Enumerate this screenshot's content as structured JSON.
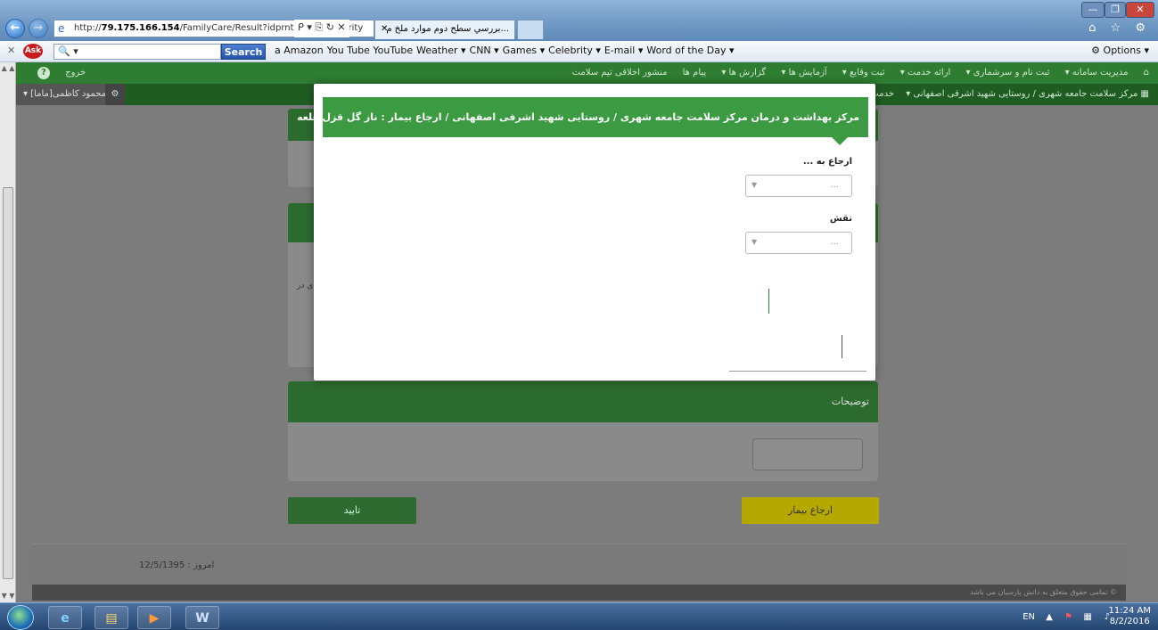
{
  "browser": {
    "url_prefix": "http://",
    "url_host": "79.175.166.154",
    "url_path": "/FamilyCare/Result?idprnt=7533&priority",
    "url_tools": "ᑭ ▾ ⎘ ↻ ✕",
    "tab_title": "...بررسي سطح دوم موارد ملخ م",
    "tab_close": "✕",
    "window_controls": [
      "—",
      "❐",
      "✕"
    ],
    "right_icons": "⌂ ☆ ⚙"
  },
  "toolbar": {
    "close": "✕",
    "ask_logo": "Ask",
    "search_placeholder": "🔍 ▾",
    "search_button": "Search",
    "items": [
      "a Amazon",
      "You Tube YouTube",
      "Weather ▾",
      "CNN ▾",
      "Games ▾",
      "Celebrity ▾",
      "E-mail ▾",
      "Word of the Day ▾"
    ],
    "options": "⚙ Options ▾"
  },
  "app": {
    "menu1": [
      "مدیریت سامانه ▾",
      "ثبت نام و سرشماری ▾",
      "ارائه خدمت ▾",
      "ثبت وقایع ▾",
      "آزمایش ها ▾",
      "گزارش ها ▾",
      "پیام ها",
      "منشور اخلاقی تیم سلامت"
    ],
    "logout": "خروج",
    "help_icon": "?",
    "menu2_center": "مرکز سلامت جامعه شهری / روستایی شهید اشرفی اصفهانی ▾",
    "menu2_service": "خدمت",
    "user": "محمود کاظمی[ماما] ▾",
    "descriptions_title": "توضیحات",
    "partial_text": "ی در",
    "confirm_button": "تایید",
    "refer_button": "ارجاع بیمار",
    "today_label": "امروز : 12/5/1395",
    "copyright": "© تمامی حقوق متعلق به دانش پارسیان می باشد"
  },
  "modal": {
    "title": "مرکز بهداشت و درمان مرکز سلامت جامعه شهری / روستایی شهید اشرفی اصفهانی / ارجاع بیمار : ناز گل قزل قلعه",
    "refer_to_label": "ارجاع به ...",
    "refer_to_value": "...",
    "role_label": "نقش",
    "role_value": "..."
  },
  "taskbar": {
    "lang": "EN",
    "time": "11:24 AM",
    "date": "8/2/2016"
  }
}
